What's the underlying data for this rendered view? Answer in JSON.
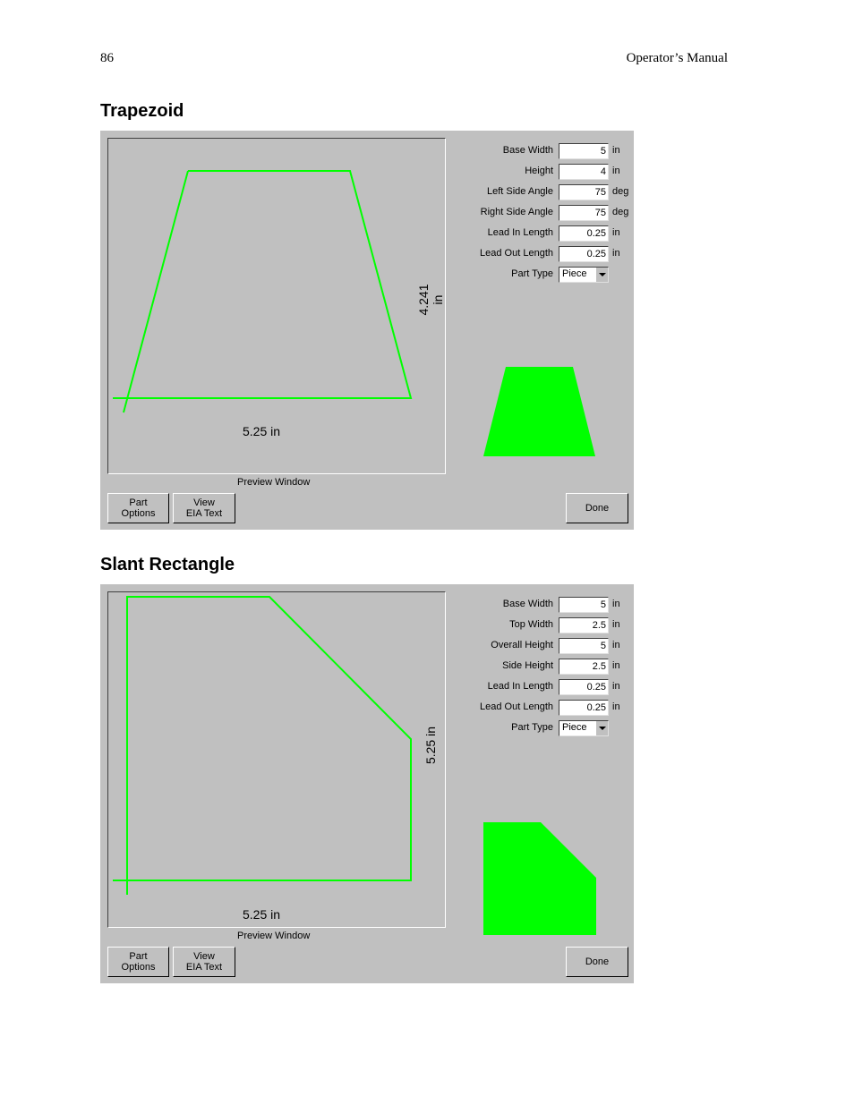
{
  "header": {
    "page_number": "86",
    "manual_title": "Operator’s Manual"
  },
  "colors": {
    "panel_bg": "#c0c0c0",
    "shape_green": "#00ff00"
  },
  "sections": [
    {
      "title": "Trapezoid",
      "preview": {
        "width_label": "5.25 in",
        "height_label": "4.241 in",
        "caption": "Preview Window"
      },
      "fields": [
        {
          "label": "Base Width",
          "value": "5",
          "unit": "in"
        },
        {
          "label": "Height",
          "value": "4",
          "unit": "in"
        },
        {
          "label": "Left Side Angle",
          "value": "75",
          "unit": "deg"
        },
        {
          "label": "Right Side Angle",
          "value": "75",
          "unit": "deg"
        },
        {
          "label": "Lead In Length",
          "value": "0.25",
          "unit": "in"
        },
        {
          "label": "Lead Out Length",
          "value": "0.25",
          "unit": "in"
        }
      ],
      "part_type": {
        "label": "Part Type",
        "value": "Piece"
      },
      "buttons": {
        "part_options_line1": "Part",
        "part_options_line2": "Options",
        "view_line1": "View",
        "view_line2": "EIA Text",
        "done": "Done"
      }
    },
    {
      "title": "Slant Rectangle",
      "preview": {
        "width_label": "5.25 in",
        "height_label": "5.25 in",
        "caption": "Preview Window"
      },
      "fields": [
        {
          "label": "Base Width",
          "value": "5",
          "unit": "in"
        },
        {
          "label": "Top Width",
          "value": "2.5",
          "unit": "in"
        },
        {
          "label": "Overall Height",
          "value": "5",
          "unit": "in"
        },
        {
          "label": "Side Height",
          "value": "2.5",
          "unit": "in"
        },
        {
          "label": "Lead In Length",
          "value": "0.25",
          "unit": "in"
        },
        {
          "label": "Lead Out Length",
          "value": "0.25",
          "unit": "in"
        }
      ],
      "part_type": {
        "label": "Part Type",
        "value": "Piece"
      },
      "buttons": {
        "part_options_line1": "Part",
        "part_options_line2": "Options",
        "view_line1": "View",
        "view_line2": "EIA Text",
        "done": "Done"
      }
    }
  ]
}
